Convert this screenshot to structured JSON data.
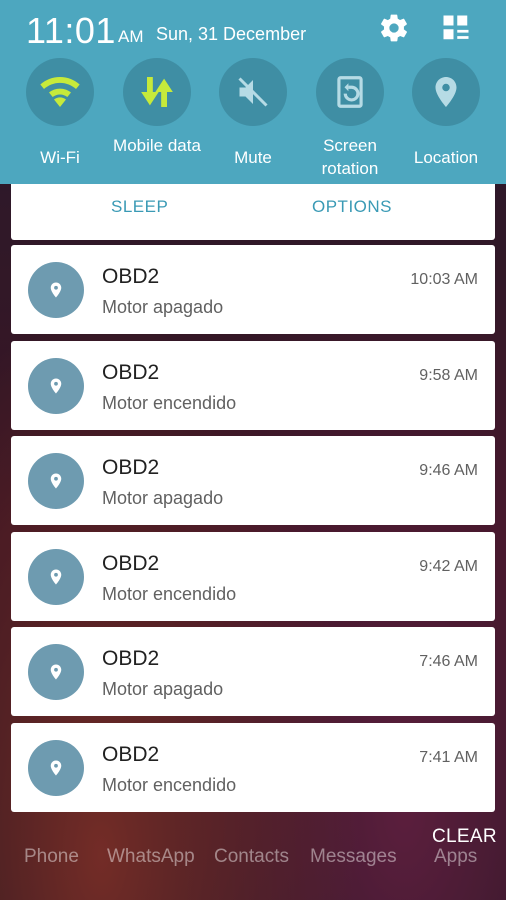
{
  "status": {
    "time": "11:01",
    "ampm": "AM",
    "date": "Sun, 31 December",
    "icons": [
      "settings-icon",
      "edit-grid-icon"
    ]
  },
  "quick_toggles": [
    {
      "label": "Wi-Fi",
      "icon": "wifi-icon",
      "active": true
    },
    {
      "label": "Mobile data",
      "icon": "mobile-data-icon",
      "active": true
    },
    {
      "label": "Mute",
      "icon": "mute-icon",
      "active": false
    },
    {
      "label": "Screen rotation",
      "icon": "screen-rotation-icon",
      "active": false
    },
    {
      "label": "Location",
      "icon": "location-icon",
      "active": false
    }
  ],
  "actions": {
    "sleep": "SLEEP",
    "options": "OPTIONS"
  },
  "notifications": [
    {
      "title": "OBD2",
      "body": "Motor apagado",
      "time": "10:03 AM"
    },
    {
      "title": "OBD2",
      "body": "Motor encendido",
      "time": "9:58 AM"
    },
    {
      "title": "OBD2",
      "body": "Motor apagado",
      "time": "9:46 AM"
    },
    {
      "title": "OBD2",
      "body": "Motor encendido",
      "time": "9:42 AM"
    },
    {
      "title": "OBD2",
      "body": "Motor apagado",
      "time": "7:46 AM"
    },
    {
      "title": "OBD2",
      "body": "Motor encendido",
      "time": "7:41 AM"
    }
  ],
  "dock": {
    "apps": [
      "Phone",
      "WhatsApp",
      "Contacts",
      "Messages",
      "Apps"
    ],
    "clear_label": "CLEAR"
  },
  "colors": {
    "panel": "#4da7bf",
    "active_icon": "#c6ea3b",
    "inactive_icon": "#b6dbe5",
    "accent_text": "#3a9ab5",
    "avatar": "#6e9bb0"
  }
}
